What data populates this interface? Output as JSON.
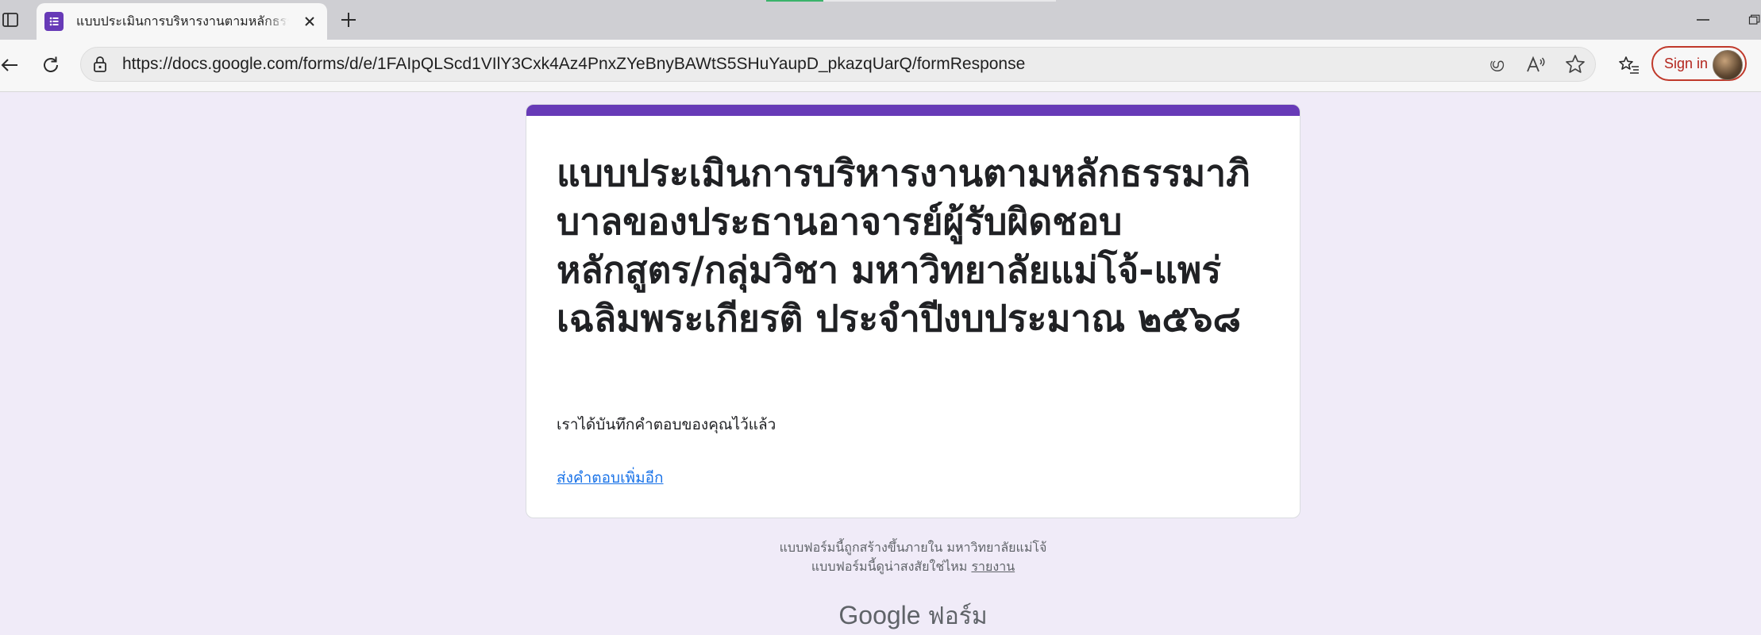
{
  "browser": {
    "tab_title": "แบบประเมินการบริหารงานตามหลักธรรมาภิบาล",
    "url": "https://docs.google.com/forms/d/e/1FAIpQLScd1VIlY3Cxk4Az4PnxZYeBnyBAWtS5SHuYaupD_pkazqUarQ/formResponse",
    "sign_in_label": "Sign in",
    "translate_icon_text": "ഗ്ര"
  },
  "form": {
    "accent_color": "#673ab7",
    "title": "แบบประเมินการบริหารงานตามหลักธรรมาภิบาลของประธานอาจารย์ผู้รับผิดชอบหลักสูตร/กลุ่มวิชา มหาวิทยาลัยแม่โจ้-แพร่ เฉลิมพระเกียรติ ประจำปีงบประมาณ  ๒๕๖๘",
    "confirmation_message": "เราได้บันทึกคำตอบของคุณไว้แล้ว",
    "another_response_link": "ส่งคำตอบเพิ่มอีก"
  },
  "footer": {
    "created_in": "แบบฟอร์มนี้ถูกสร้างขึ้นภายใน มหาวิทยาลัยแม่โจ้",
    "suspicious_question": "แบบฟอร์มนี้ดูน่าสงสัยใช่ไหม",
    "report_link": "รายงาน",
    "logo_google": "Google",
    "logo_product": "ฟอร์ม"
  }
}
